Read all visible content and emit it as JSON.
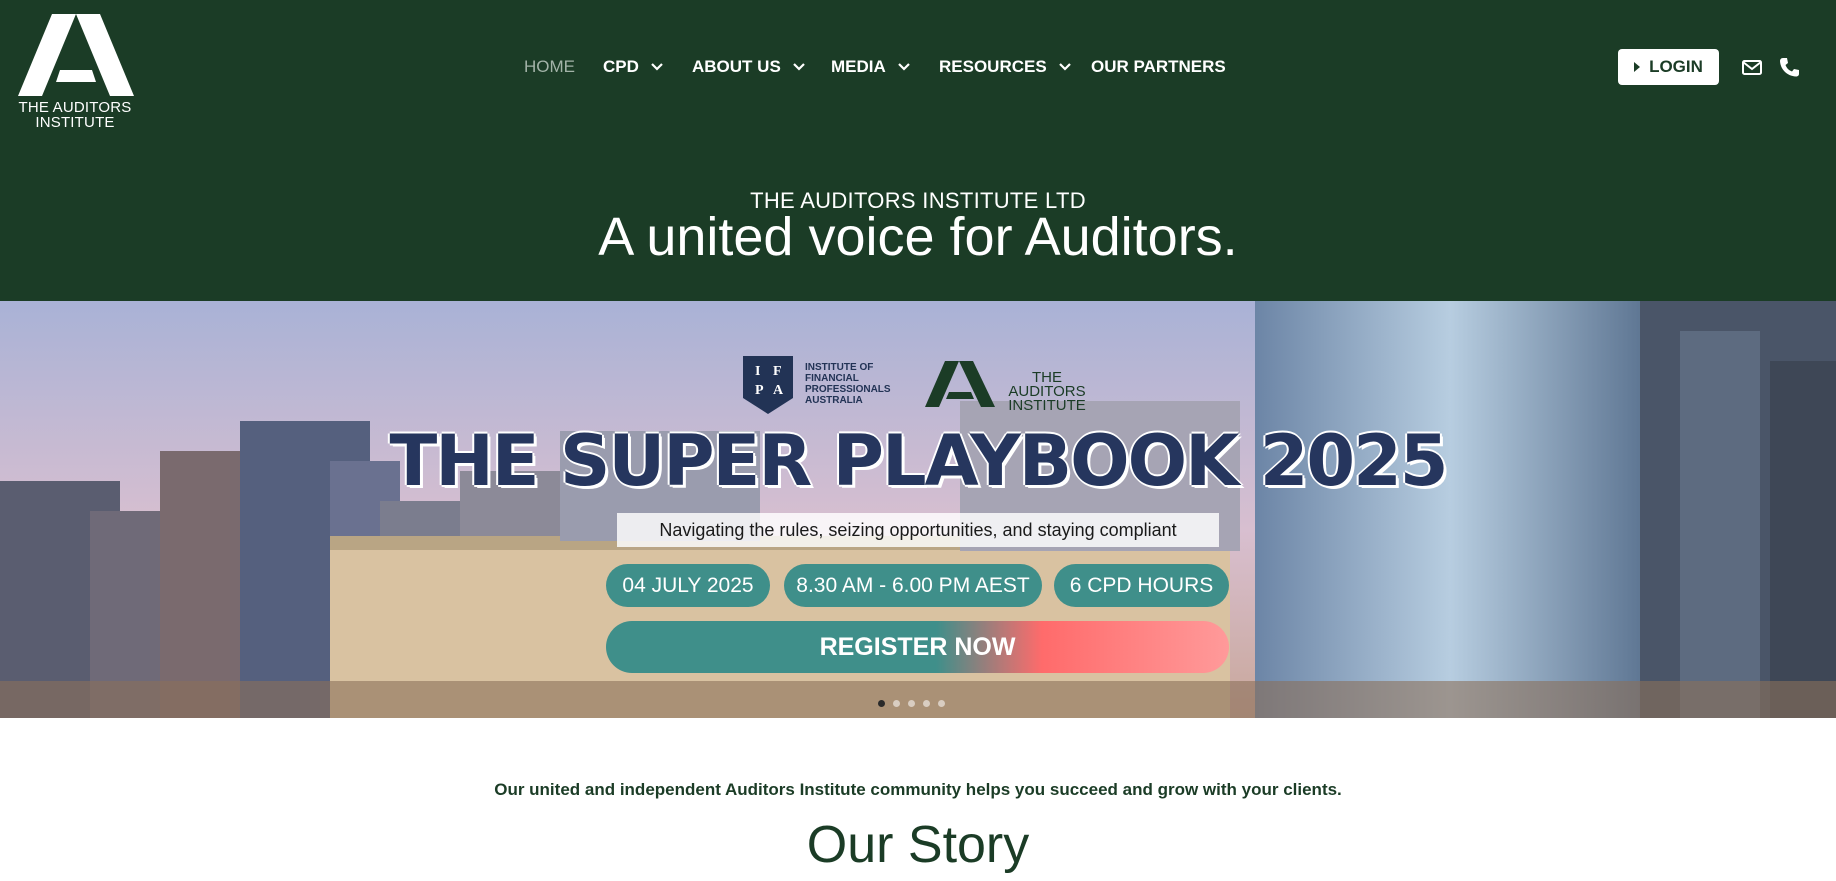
{
  "header": {
    "logo_text": "THE AUDITORS INSTITUTE",
    "nav": [
      {
        "label": "HOME",
        "dropdown": false
      },
      {
        "label": "CPD",
        "dropdown": true
      },
      {
        "label": "ABOUT US",
        "dropdown": true
      },
      {
        "label": "MEDIA",
        "dropdown": true
      },
      {
        "label": "RESOURCES",
        "dropdown": true
      },
      {
        "label": "OUR PARTNERS",
        "dropdown": false
      }
    ],
    "login_label": "LOGIN",
    "icons": [
      "envelope-icon",
      "phone-icon"
    ]
  },
  "banner": {
    "org_name": "THE AUDITORS INSTITUTE LTD",
    "tagline": "A united voice for Auditors."
  },
  "hero": {
    "ifpa_letters": [
      "I",
      "F",
      "P",
      "A"
    ],
    "ifpa_text": "INSTITUTE OF FINANCIAL PROFESSIONALS AUSTRALIA",
    "partner_logo_text": "THE AUDITORS INSTITUTE",
    "title": "THE SUPER PLAYBOOK 2025",
    "subtitle": "Navigating the rules, seizing opportunities, and staying compliant",
    "date": "04 JULY 2025",
    "time": "8.30 AM - 6.00 PM AEST",
    "cpd": "6 CPD HOURS",
    "cta": "REGISTER NOW",
    "slides": 5,
    "active_slide": 1
  },
  "content": {
    "intro": "Our united and independent Auditors Institute community helps you succeed and grow with your clients.",
    "section_title": "Our Story"
  },
  "colors": {
    "brand_green": "#1b3c26",
    "teal": "#3f8f8a",
    "navy": "#26365e",
    "coral": "#ff8a8a"
  }
}
